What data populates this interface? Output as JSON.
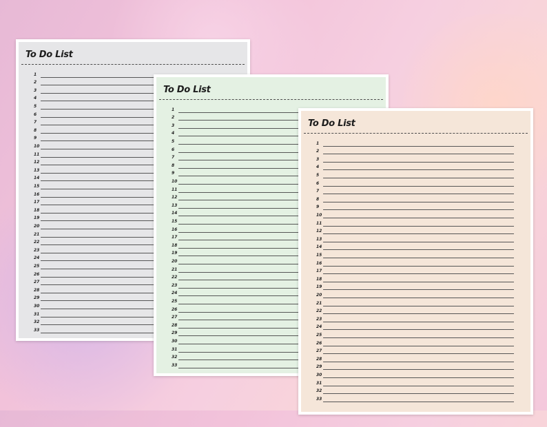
{
  "pages": [
    {
      "title": "To Do List",
      "background": "#e6e6e8"
    },
    {
      "title": "To Do List",
      "background": "#e4f1e3"
    },
    {
      "title": "To Do List",
      "background": "#f5e6d9"
    }
  ],
  "items": [
    "1",
    "2",
    "3",
    "4",
    "5",
    "6",
    "7",
    "8",
    "9",
    "10",
    "11",
    "12",
    "13",
    "14",
    "15",
    "16",
    "17",
    "18",
    "19",
    "20",
    "21",
    "22",
    "23",
    "24",
    "25",
    "26",
    "27",
    "28",
    "29",
    "30",
    "31",
    "32",
    "33"
  ]
}
